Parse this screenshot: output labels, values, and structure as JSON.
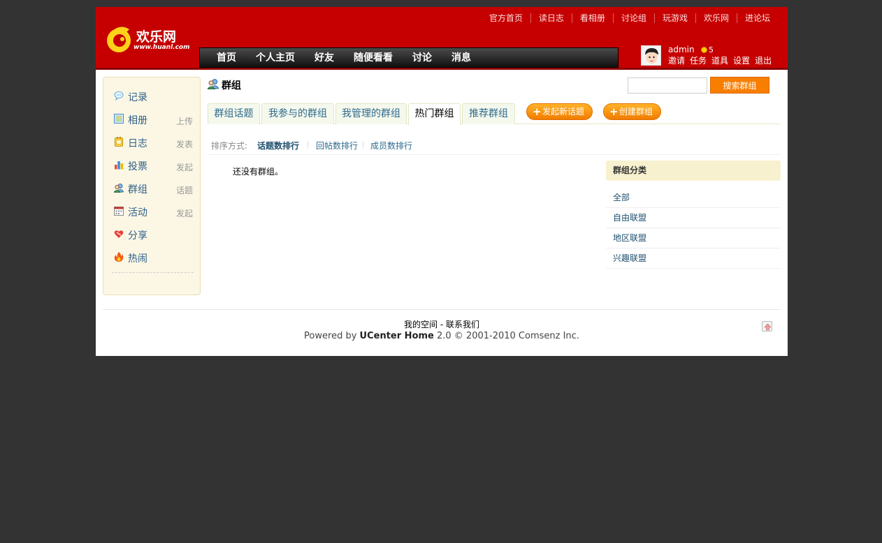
{
  "header": {
    "logo_name": "欢乐网",
    "logo_url": "www.huanl.com",
    "top_links": [
      "官方首页",
      "读日志",
      "看相册",
      "讨论组",
      "玩游戏",
      "欢乐网",
      "进论坛"
    ],
    "nav": [
      "首页",
      "个人主页",
      "好友",
      "随便看看",
      "讨论",
      "消息"
    ],
    "user": {
      "name": "admin",
      "credit": "5",
      "menu": [
        "邀请",
        "任务",
        "道具",
        "设置",
        "退出"
      ]
    }
  },
  "sidebar": {
    "items": [
      {
        "label": "记录",
        "action": "",
        "icon": "speech-bubble-icon"
      },
      {
        "label": "相册",
        "action": "上传",
        "icon": "photo-icon"
      },
      {
        "label": "日志",
        "action": "发表",
        "icon": "notepad-icon"
      },
      {
        "label": "投票",
        "action": "发起",
        "icon": "bar-chart-icon"
      },
      {
        "label": "群组",
        "action": "话题",
        "icon": "group-icon"
      },
      {
        "label": "活动",
        "action": "发起",
        "icon": "calendar-icon"
      },
      {
        "label": "分享",
        "action": "",
        "icon": "heart-icon"
      },
      {
        "label": "热闹",
        "action": "",
        "icon": "fire-icon"
      }
    ]
  },
  "main": {
    "title": "群组",
    "search": {
      "value": "",
      "button": "搜索群组"
    },
    "tabs": [
      "群组话题",
      "我参与的群组",
      "我管理的群组",
      "热门群组",
      "推荐群组"
    ],
    "active_tab": "热门群组",
    "actions": [
      "发起新话题",
      "创建群组"
    ],
    "sort": {
      "label": "排序方式:",
      "options": [
        "话题数排行",
        "回帖数排行",
        "成员数排行"
      ],
      "active": "话题数排行"
    },
    "empty_message": "还没有群组。",
    "categories": {
      "title": "群组分类",
      "items": [
        "全部",
        "自由联盟",
        "地区联盟",
        "兴趣联盟"
      ]
    }
  },
  "footer": {
    "link1": "我的空间",
    "separator": "-",
    "link2": "联系我们",
    "powered_prefix": "Powered by",
    "powered_product": "UCenter Home",
    "powered_suffix": "2.0 © 2001-2010 Comsenz Inc."
  },
  "colors": {
    "header_red": "#c60000",
    "accent_orange": "#f87e00",
    "sidebar_bg": "#fbf7e4",
    "link_blue": "#2e6a8d"
  }
}
